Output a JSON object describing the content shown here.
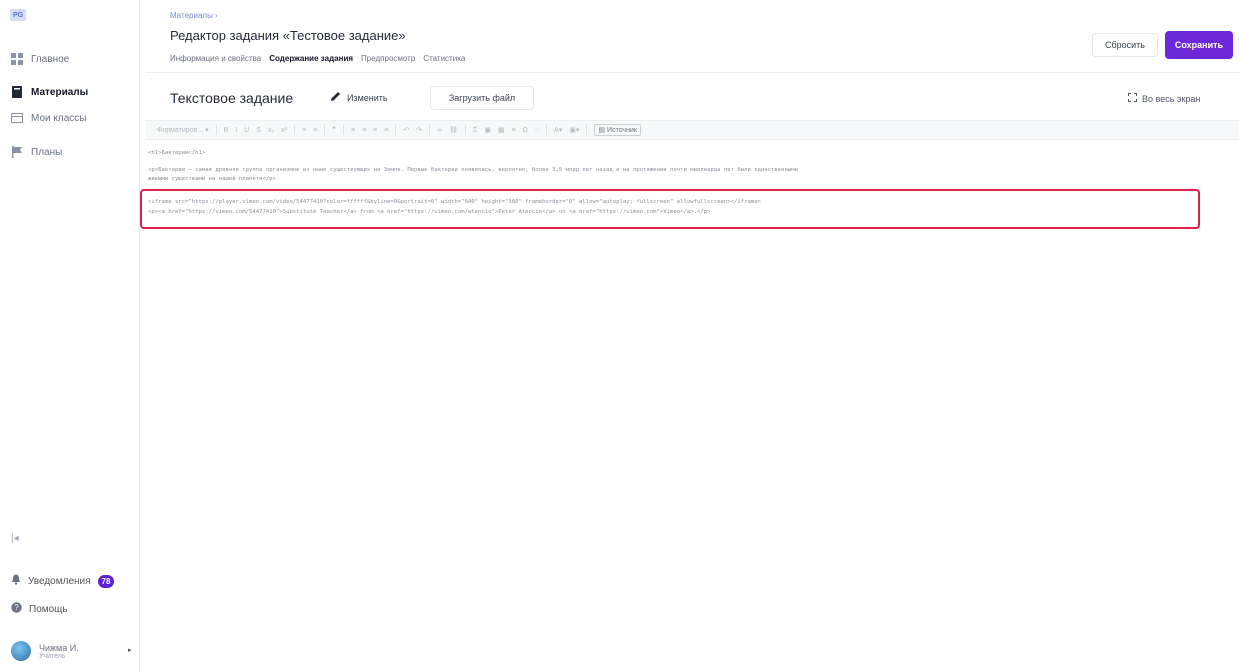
{
  "app": {
    "logo": "PG"
  },
  "sidebar": {
    "items": [
      {
        "label": "Главное",
        "icon": "dashboard-icon",
        "active": false
      },
      {
        "label": "Материалы",
        "icon": "book-icon",
        "active": true
      },
      {
        "label": "Мои классы",
        "icon": "class-icon",
        "active": false
      },
      {
        "label": "Планы",
        "icon": "flag-icon",
        "active": false
      }
    ],
    "collapse_glyph": "|◂",
    "notifications_label": "Уведомления",
    "notifications_count": "78",
    "help_label": "Помощь",
    "user_name": "Чижма И.",
    "user_role": "Учитель"
  },
  "header": {
    "breadcrumb": "Материалы ›",
    "title": "Редактор задания «Тестовое задание»",
    "tabs": [
      {
        "label": "Информация и свойства",
        "active": false
      },
      {
        "label": "Содержание задания",
        "active": true
      },
      {
        "label": "Предпросмотр",
        "active": false
      },
      {
        "label": "Статистика",
        "active": false
      }
    ],
    "reset_label": "Сбросить",
    "save_label": "Сохранить"
  },
  "content": {
    "task_title": "Текстовое задание",
    "edit_label": "Изменить",
    "upload_label": "Загрузить файл",
    "fullscreen_label": "Во весь экран"
  },
  "toolbar": {
    "format_label": "Форматиров...",
    "buttons": [
      "B",
      "I",
      "U",
      "S",
      "x₂",
      "x²",
      "≡",
      "≡",
      "❞",
      "≡",
      "≡",
      "≡",
      "≡",
      "↶",
      "↷",
      "∞",
      "⛓",
      "Σ",
      "▣",
      "▦",
      "≡",
      "Ω",
      "◌",
      "A",
      "▣"
    ],
    "source_label": "Источник"
  },
  "editor": {
    "lines": [
      "<h1>Бактерии</h1>",
      "<p>Бактерии — самая древняя группа организмов из ныне существующих на Земле. Первые бактерии появились, вероятно, более  3,5  млрд лет назад и на протяжении почти миллиарда лет были единственными",
      "живыми существами на нашей планете</p>",
      "<iframe src=\"https://player.vimeo.com/video/54477410?color=ffffff&byline=0&portrait=0\" width=\"640\" height=\"360\" frameborder=\"0\" allow=\"autoplay; fullscreen\" allowfullscreen></iframe>",
      "<p><a href=\"https://vimeo.com/54477410\">Substitute Teacher</a> from <a href=\"https://vimeo.com/atencio\">Peter Atencio</a> on <a href=\"https://vimeo.com\">Vimeo</a>.</p>"
    ]
  },
  "colors": {
    "accent": "#6d28d9",
    "highlight_border": "#e11d48"
  }
}
